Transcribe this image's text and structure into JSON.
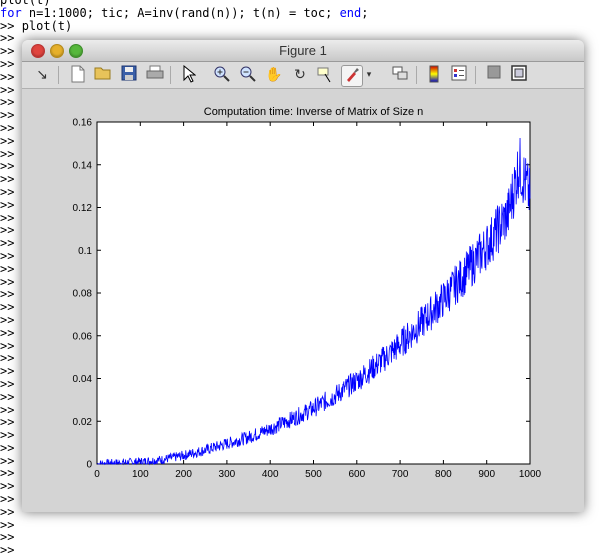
{
  "console": {
    "lines": [
      {
        "prompt": "",
        "text": "plot(t)"
      },
      {
        "prompt": "",
        "kw1": "for",
        "mid": " n=1:1000; tic; A=inv(rand(n)); t(n) = toc; ",
        "kw2": "end",
        "tail": ";"
      },
      {
        "prompt": ">> ",
        "text": "plot(t)"
      },
      {
        "prompt": ">> ",
        "text": ""
      }
    ],
    "prompt_symbol": ">>",
    "prompt_count": 44
  },
  "figure": {
    "title": "Figure 1",
    "toolbar_icons": [
      "dock-arrow-icon",
      "new-figure-icon",
      "open-file-icon",
      "save-icon",
      "print-icon",
      "pointer-icon",
      "zoom-in-icon",
      "zoom-out-icon",
      "pan-hand-icon",
      "rotate-3d-icon",
      "data-cursor-icon",
      "brush-icon",
      "brush-menu-icon",
      "link-plot-icon",
      "colorbar-icon",
      "legend-icon",
      "hide-plot-tools-icon",
      "show-plot-tools-icon"
    ]
  },
  "chart_data": {
    "type": "line",
    "title": "Computation time: Inverse of Matrix of Size n",
    "xlabel": "",
    "ylabel": "",
    "xlim": [
      0,
      1000
    ],
    "ylim": [
      0,
      0.16
    ],
    "xticks": [
      "0",
      "100",
      "200",
      "300",
      "400",
      "500",
      "600",
      "700",
      "800",
      "900",
      "1000"
    ],
    "yticks": [
      "0",
      "0.02",
      "0.04",
      "0.06",
      "0.08",
      "0.1",
      "0.12",
      "0.14",
      "0.16"
    ],
    "color": "#0000ff",
    "grid": false,
    "series": [
      {
        "x": [
          1,
          50,
          100,
          150,
          200,
          250,
          300,
          350,
          400,
          450,
          500,
          550,
          600,
          650,
          700,
          750,
          800,
          850,
          900,
          950,
          975,
          1000
        ],
        "y": [
          0,
          0.0005,
          0.001,
          0.002,
          0.004,
          0.0065,
          0.0095,
          0.0125,
          0.0165,
          0.021,
          0.026,
          0.032,
          0.039,
          0.047,
          0.056,
          0.066,
          0.077,
          0.089,
          0.102,
          0.117,
          0.14,
          0.125
        ]
      }
    ]
  }
}
